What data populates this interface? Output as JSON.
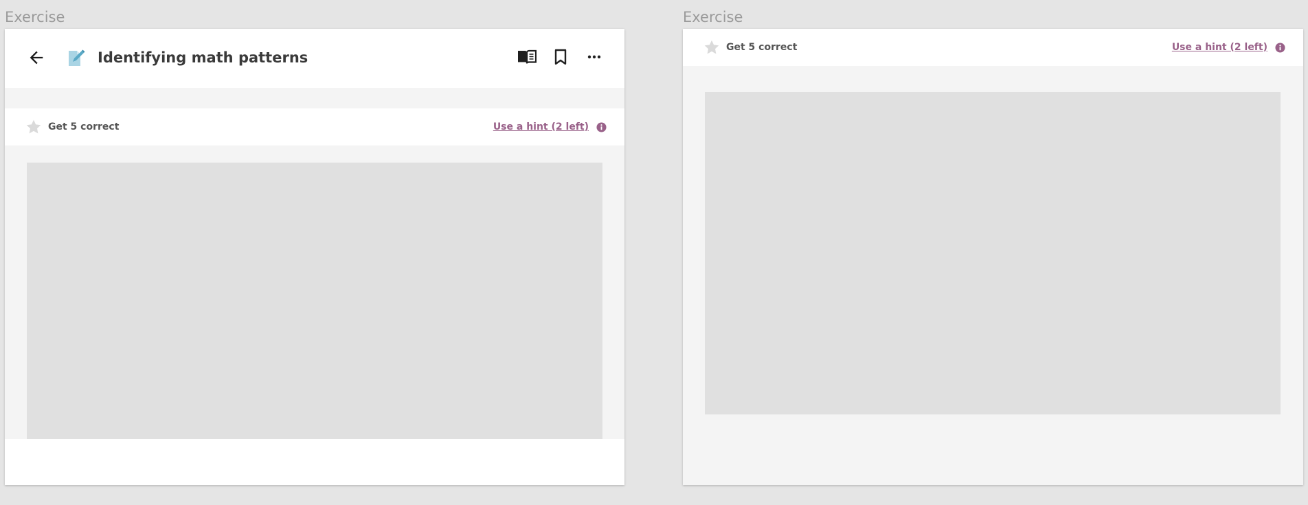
{
  "frames": [
    {
      "label": "Exercise",
      "header": {
        "title": "Identifying math patterns",
        "back_icon": "arrow-left-icon",
        "exercise_icon": "exercise-pencil-icon",
        "actions": [
          "book-resources-icon",
          "bookmark-icon",
          "more-horizontal-icon"
        ]
      },
      "status": {
        "goal": "Get 5 correct",
        "hint": "Use a hint (2 left)"
      }
    },
    {
      "label": "Exercise",
      "status": {
        "goal": "Get 5 correct",
        "hint": "Use a hint (2 left)"
      }
    }
  ],
  "colors": {
    "hint": "#996189",
    "title": "#3a3a3a",
    "placeholder": "#e0e0e0",
    "exercise_icon": "#9fd0e2",
    "star_empty": "#dadada"
  }
}
